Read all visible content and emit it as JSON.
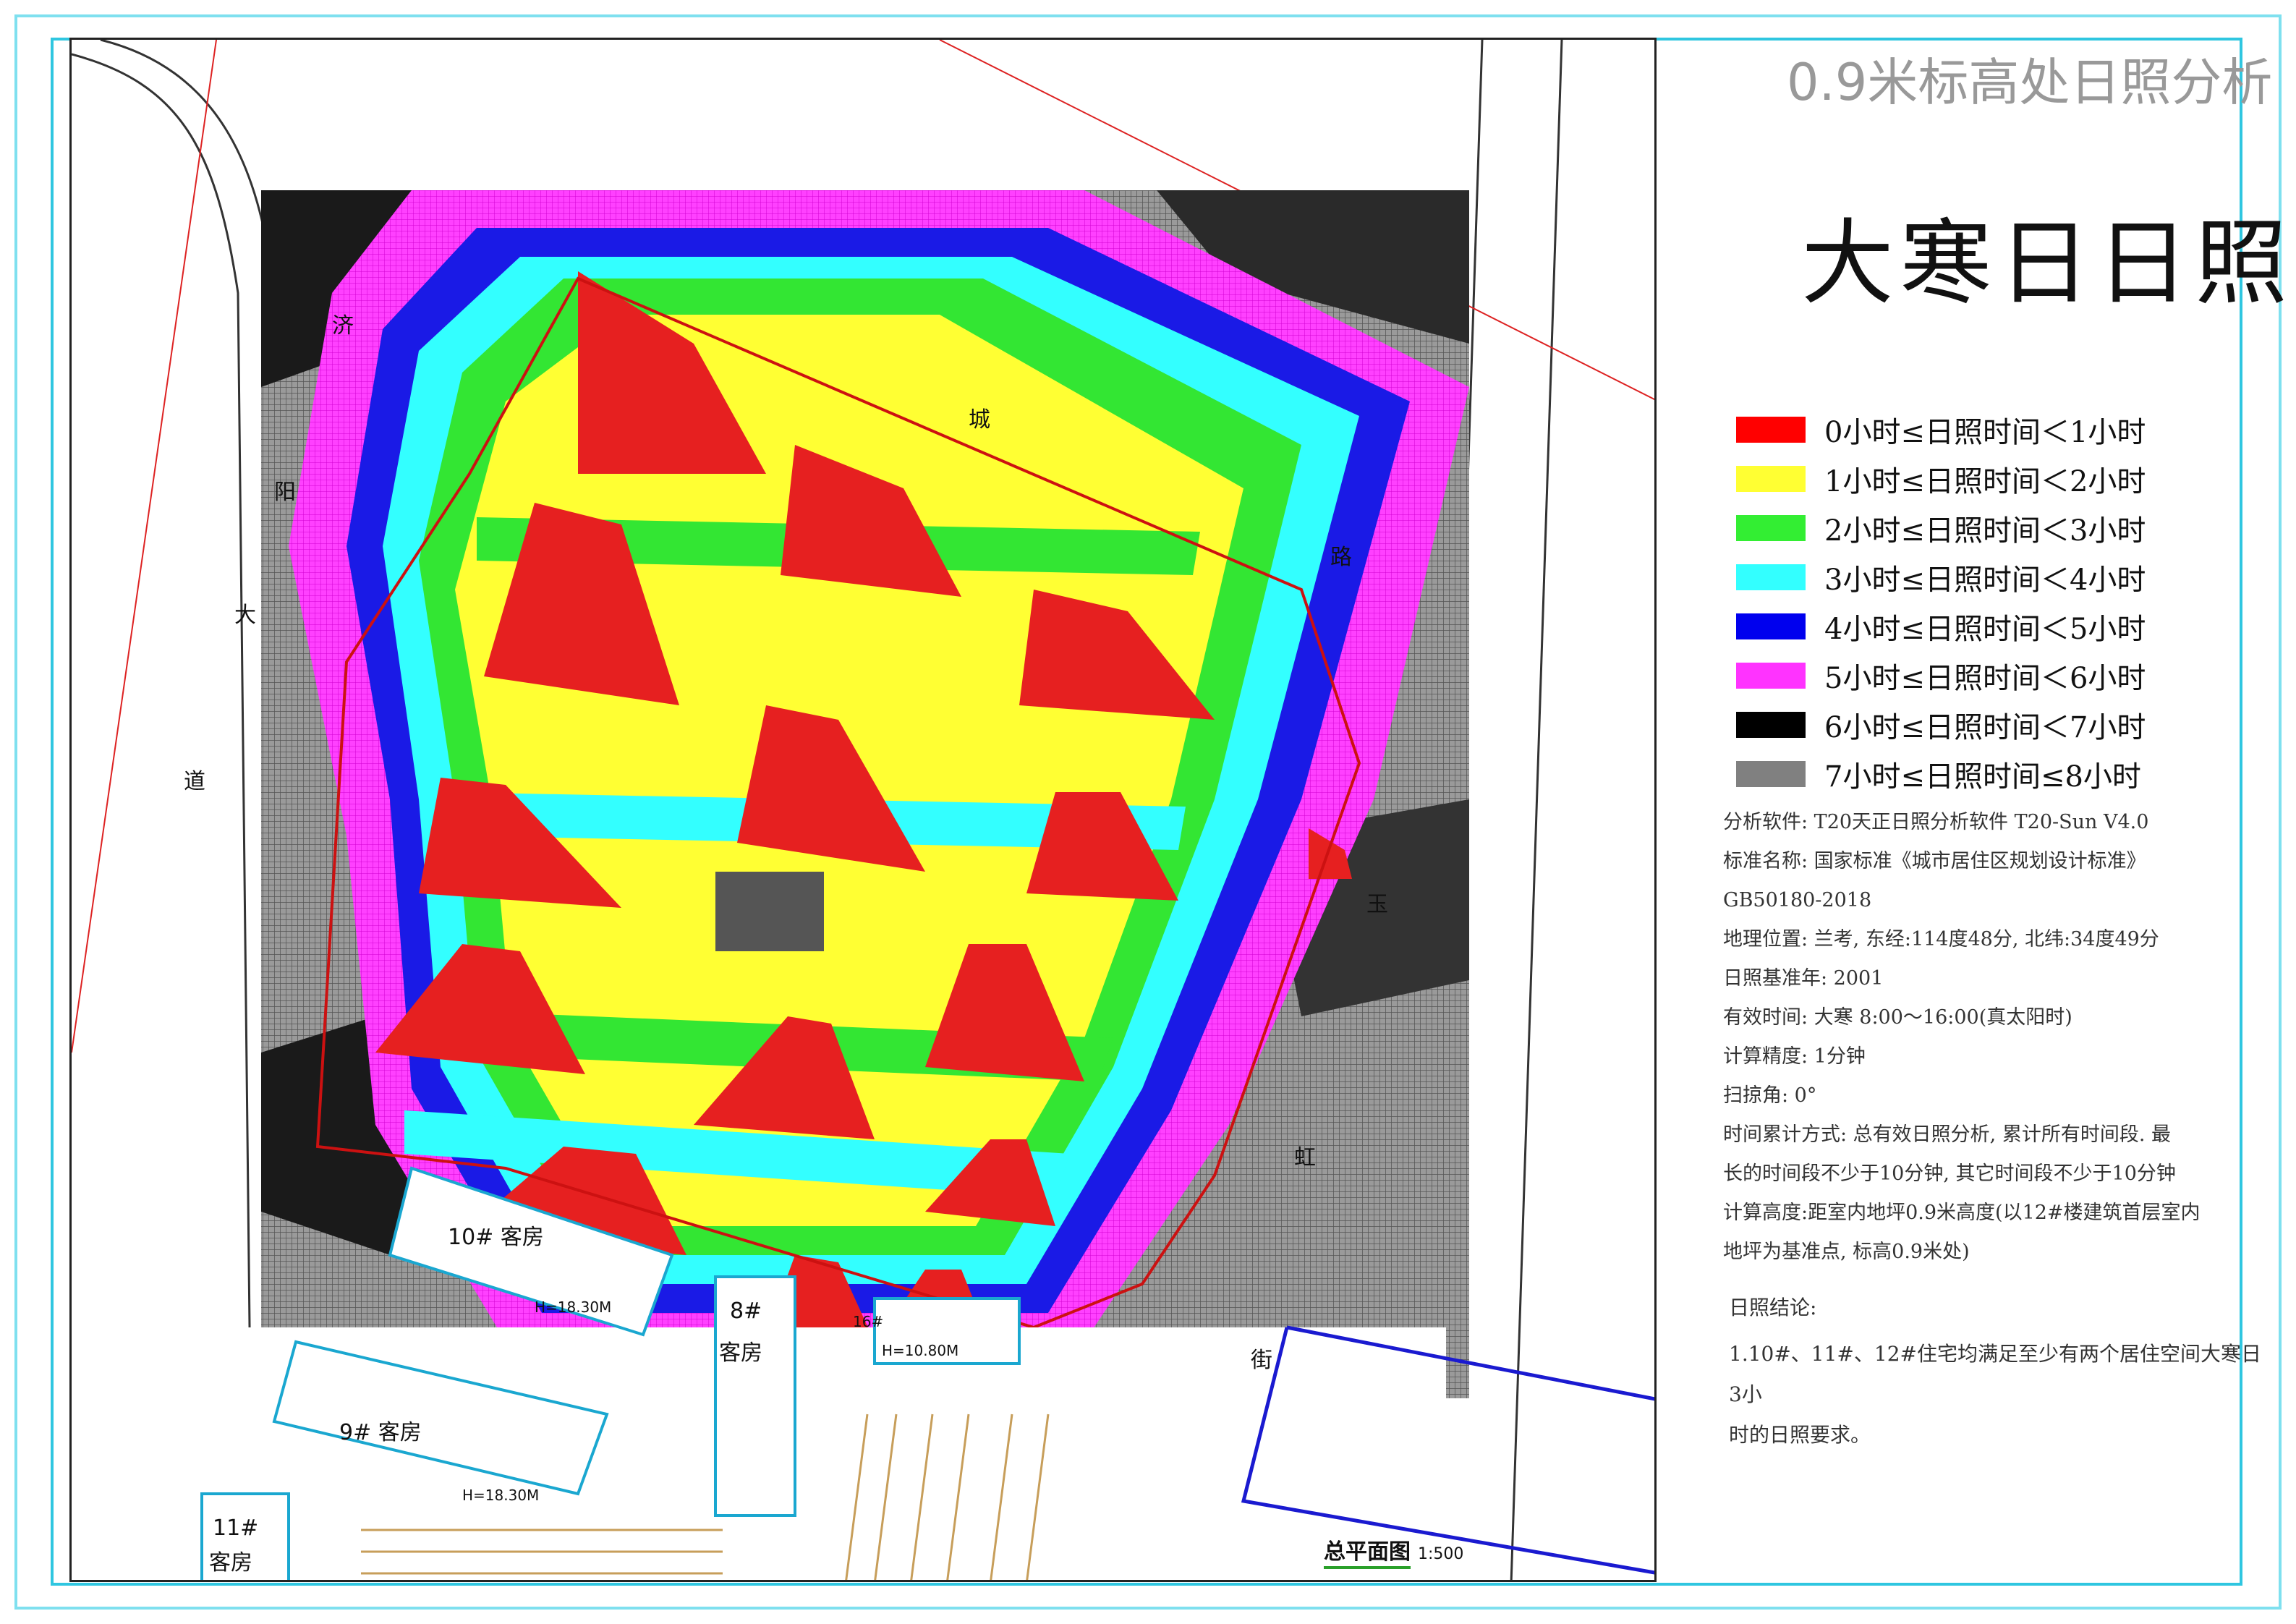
{
  "subtitle": "0.9米标高处日照分析",
  "title": "大寒日日照",
  "legend": [
    {
      "color": "#ff0000",
      "label": "0小时≤日照时间＜1小时"
    },
    {
      "color": "#ffff33",
      "label": "1小时≤日照时间＜2小时"
    },
    {
      "color": "#33ee33",
      "label": "2小时≤日照时间＜3小时"
    },
    {
      "color": "#33ffff",
      "label": "3小时≤日照时间＜4小时"
    },
    {
      "color": "#0000ee",
      "label": "4小时≤日照时间＜5小时"
    },
    {
      "color": "#ff33ff",
      "label": "5小时≤日照时间＜6小时"
    },
    {
      "color": "#000000",
      "label": "6小时≤日照时间＜7小时"
    },
    {
      "color": "#808080",
      "label": "7小时≤日照时间≤8小时"
    }
  ],
  "info": [
    "分析软件: T20天正日照分析软件 T20-Sun V4.0",
    "标准名称: 国家标准《城市居住区规划设计标准》",
    "GB50180-2018",
    "地理位置: 兰考, 东经:114度48分, 北纬:34度49分",
    "日照基准年: 2001",
    "有效时间: 大寒 8:00～16:00(真太阳时)",
    "计算精度: 1分钟",
    "扫掠角: 0°",
    "时间累计方式: 总有效日照分析, 累计所有时间段. 最",
    "长的时间段不少于10分钟, 其它时间段不少于10分钟",
    "计算高度:距室内地坪0.9米高度(以12#楼建筑首层室内",
    "地坪为基准点, 标高0.9米处)"
  ],
  "conclusion": {
    "heading": "日照结论:",
    "lines": [
      "1.10#、11#、12#住宅均满足至少有两个居住空间大寒日3小",
      "时的日照要求。"
    ]
  },
  "map": {
    "caption": "总平面图",
    "scale": "1:500",
    "buildings": {
      "b10": "10# 客房",
      "b10_h": "H=18.30M",
      "b9": "9# 客房",
      "b9_h": "H=18.30M",
      "b8": "8#",
      "b8_sub": "客房",
      "b11": "11#",
      "b11_sub": "客房",
      "b16": "16#",
      "b16_h": "H=10.80M"
    },
    "street_chars": [
      "大",
      "道",
      "阳",
      "济",
      "玉",
      "虹",
      "街",
      "城",
      "路"
    ]
  }
}
